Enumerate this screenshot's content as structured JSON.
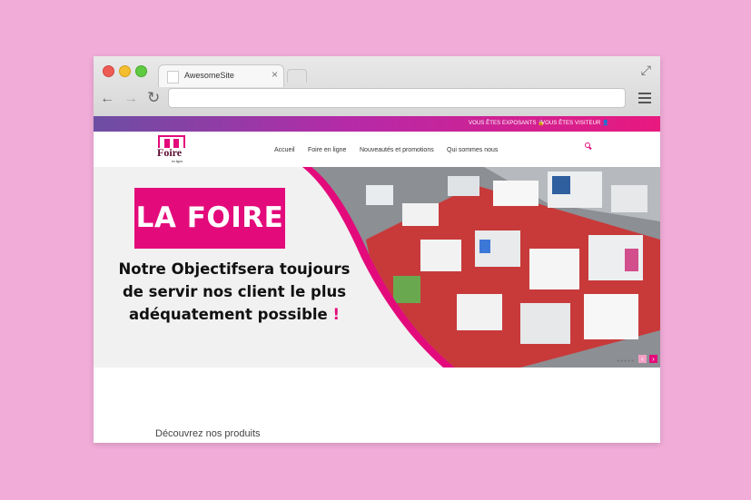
{
  "browser": {
    "tab_title": "AwesomeSite",
    "tab_close": "×",
    "url": ""
  },
  "site": {
    "topbar": {
      "exposant": "VOUS ÊTES EXPOSANTS 🔒",
      "visiteur": "VOUS ÊTES VISITEUR 👤"
    },
    "logo": {
      "text": "Foire",
      "subtext": "en ligne"
    },
    "nav": [
      "Accueil",
      "Foire en ligne",
      "Nouveautés et promotions",
      "Qui sommes nous"
    ],
    "hero": {
      "badge": "LA FOIRE",
      "headline_line1": "Notre Objectifsera toujours",
      "headline_line2": "de servir nos client le plus",
      "headline_line3": "adéquatement possible",
      "headline_excl": "!",
      "slider_dots": "●●●●●"
    },
    "section_title": "Découvrez nos produits"
  },
  "colors": {
    "page_bg": "#f1acd8",
    "accent": "#e30b7b",
    "topbar_start": "#6c4ea3",
    "topbar_end": "#e8197f"
  },
  "icons": [
    "expand-icon",
    "back-icon",
    "forward-icon",
    "reload-icon",
    "menu-icon",
    "lock-icon",
    "user-icon",
    "search-icon",
    "chevron-left-icon",
    "chevron-right-icon"
  ]
}
